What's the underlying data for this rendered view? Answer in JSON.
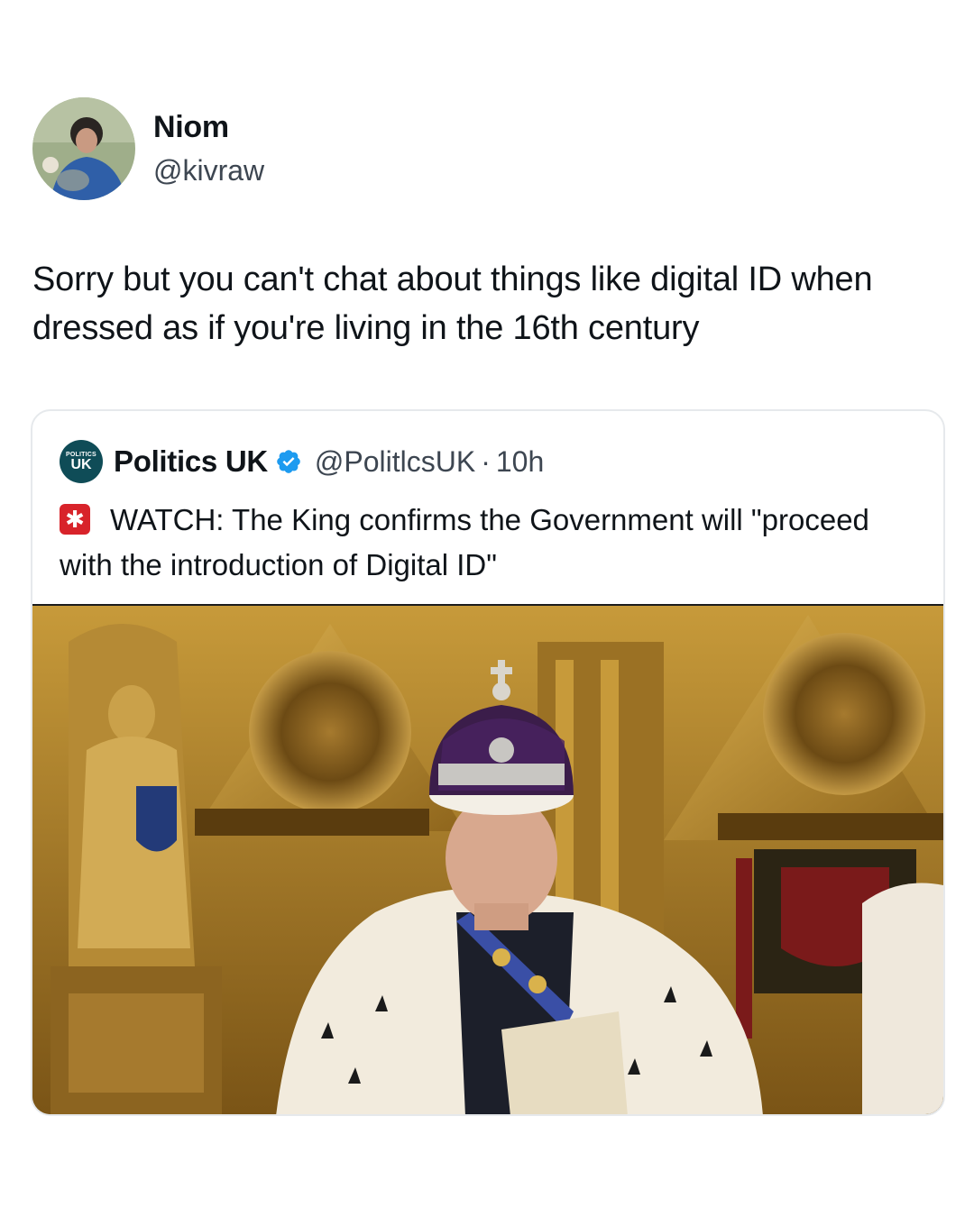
{
  "author": {
    "display_name": "Niom",
    "handle": "@kivraw",
    "avatar": "profile-photo"
  },
  "tweet": {
    "text": "Sorry but you can't chat about things like digital ID when dressed as if you're living in the 16th century"
  },
  "quoted_tweet": {
    "logo_top": "POLITICS",
    "logo_bottom": "UK",
    "display_name": "Politics UK",
    "verified_icon": "verified-badge-icon",
    "handle": "@PolitlcsUK",
    "separator": "·",
    "time": "10h",
    "emoji": "siren-emoji",
    "text": "WATCH: The King confirms the Government will \"proceed with the introduction of Digital ID\"",
    "media": "photo-king-on-throne"
  },
  "colors": {
    "text": "#0f1419",
    "secondary": "#3d4651",
    "verified": "#1d9bf0",
    "border": "#e6e9ec"
  }
}
